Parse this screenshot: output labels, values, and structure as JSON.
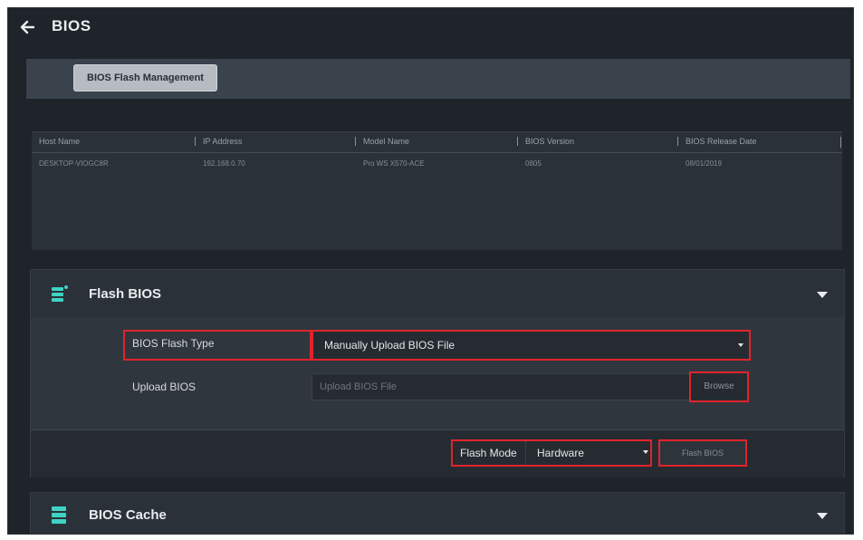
{
  "header": {
    "title": "BIOS"
  },
  "tabs": [
    {
      "label": "BIOS Flash Management"
    }
  ],
  "table": {
    "columns": [
      "Host Name",
      "IP Address",
      "Model Name",
      "BIOS Version",
      "BIOS Release Date"
    ],
    "rows": [
      [
        "DESKTOP-VIOGC8R",
        "192.168.0.70",
        "Pro WS X570-ACE",
        "0805",
        "08/01/2019"
      ]
    ]
  },
  "flash_bios": {
    "title": "Flash BIOS",
    "flash_type_label": "BIOS Flash Type",
    "flash_type_value": "Manually Upload BIOS File",
    "upload_label": "Upload BIOS",
    "upload_placeholder": "Upload BIOS File",
    "browse_label": "Browse",
    "flash_mode_label": "Flash Mode",
    "flash_mode_value": "Hardware",
    "flash_button_label": "Flash BIOS"
  },
  "bios_cache": {
    "title": "BIOS Cache"
  },
  "colors": {
    "highlight": "#e0242b",
    "accent_icon": "#3fd3c4"
  }
}
